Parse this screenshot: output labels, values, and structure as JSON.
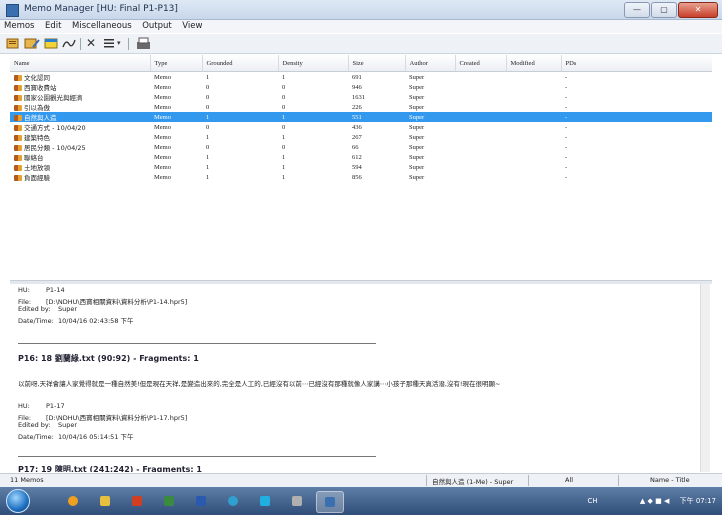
{
  "window": {
    "title": "Memo Manager [HU: Final P1-P13]",
    "buttons": [
      "—",
      "▢",
      "✕"
    ]
  },
  "menu": [
    "Memos",
    "Edit",
    "Miscellaneous",
    "Output",
    "View"
  ],
  "toolbar": {
    "icons": [
      "new-memo-icon",
      "edit-memo-icon",
      "memo-type-icon",
      "link-icon",
      "delete-icon",
      "list-view-icon",
      "export-icon"
    ]
  },
  "table": {
    "headers": [
      "Name",
      "Type",
      "Grounded",
      "Density",
      "Size",
      "Author",
      "Created",
      "Modified",
      "PDs"
    ],
    "rows": [
      {
        "name": "文化認同",
        "type": "Memo",
        "grounded": "1",
        "density": "1",
        "size": "691",
        "author": "Super",
        "created": "",
        "modified": "",
        "pds": "-"
      },
      {
        "name": "西寶收費站",
        "type": "Memo",
        "grounded": "0",
        "density": "0",
        "size": "946",
        "author": "Super",
        "created": "",
        "modified": "",
        "pds": "-"
      },
      {
        "name": "國家公園觀光與經濟",
        "type": "Memo",
        "grounded": "0",
        "density": "0",
        "size": "1631",
        "author": "Super",
        "created": "",
        "modified": "",
        "pds": "-"
      },
      {
        "name": "引以為傲",
        "type": "Memo",
        "grounded": "0",
        "density": "0",
        "size": "226",
        "author": "Super",
        "created": "",
        "modified": "",
        "pds": "-"
      },
      {
        "name": "自然與人造",
        "type": "Memo",
        "grounded": "1",
        "density": "1",
        "size": "551",
        "author": "Super",
        "created": "",
        "modified": "",
        "pds": "-",
        "selected": true
      },
      {
        "name": "交通方式 - 10/04/20",
        "type": "Memo",
        "grounded": "0",
        "density": "0",
        "size": "436",
        "author": "Super",
        "created": "",
        "modified": "",
        "pds": "-"
      },
      {
        "name": "建築特色",
        "type": "Memo",
        "grounded": "1",
        "density": "1",
        "size": "267",
        "author": "Super",
        "created": "",
        "modified": "",
        "pds": "-"
      },
      {
        "name": "居民分類 - 10/04/25",
        "type": "Memo",
        "grounded": "0",
        "density": "0",
        "size": "66",
        "author": "Super",
        "created": "",
        "modified": "",
        "pds": "-"
      },
      {
        "name": "聯絡台",
        "type": "Memo",
        "grounded": "1",
        "density": "1",
        "size": "612",
        "author": "Super",
        "created": "",
        "modified": "",
        "pds": "-"
      },
      {
        "name": "土地放領",
        "type": "Memo",
        "grounded": "1",
        "density": "1",
        "size": "594",
        "author": "Super",
        "created": "",
        "modified": "",
        "pds": "-"
      },
      {
        "name": "負面經驗",
        "type": "Memo",
        "grounded": "1",
        "density": "1",
        "size": "856",
        "author": "Super",
        "created": "",
        "modified": "",
        "pds": "-"
      }
    ]
  },
  "detail": {
    "block1": {
      "hu_label": "HU:",
      "hu": "P1-14",
      "file_label": "File:",
      "file": "[D:\\NDHU\\西寶相關資料\\資料分析\\P1-14.hpr5]",
      "editedby_label": "Edited by:",
      "editedby": "Super",
      "datetime_label": "Date/Time:",
      "datetime": "10/04/16 02:43:58 下午"
    },
    "p16_title": "P16: 18 劉蘭綠.txt (90:92) - Fragments: 1",
    "p16_quote": "以前呀,天祥會讓人家覺得就是一種自然美!但是現在天祥,是變造出來的,完全是人工的,已經沒有以前⋯已經沒有那種就像人家講⋯小孩子那種天真活潑,沒有!現在很明顯~",
    "block2": {
      "hu_label": "HU:",
      "hu": "P1-17",
      "file_label": "File:",
      "file": "[D:\\NDHU\\西寶相關資料\\資料分析\\P1-17.hpr5]",
      "editedby_label": "Edited by:",
      "editedby": "Super",
      "datetime_label": "Date/Time:",
      "datetime": "10/04/16 05:14:51 下午"
    },
    "p17_title": "P17: 19 陳明.txt (241:242) - Fragments: 1"
  },
  "status": {
    "count": "11 Memos",
    "current": "自然與人造 (1-Me) - Super",
    "filter": "All",
    "sort": "Name - Title"
  },
  "taskbar": {
    "tray_lang": "CH",
    "clock": "下午 07:17"
  }
}
